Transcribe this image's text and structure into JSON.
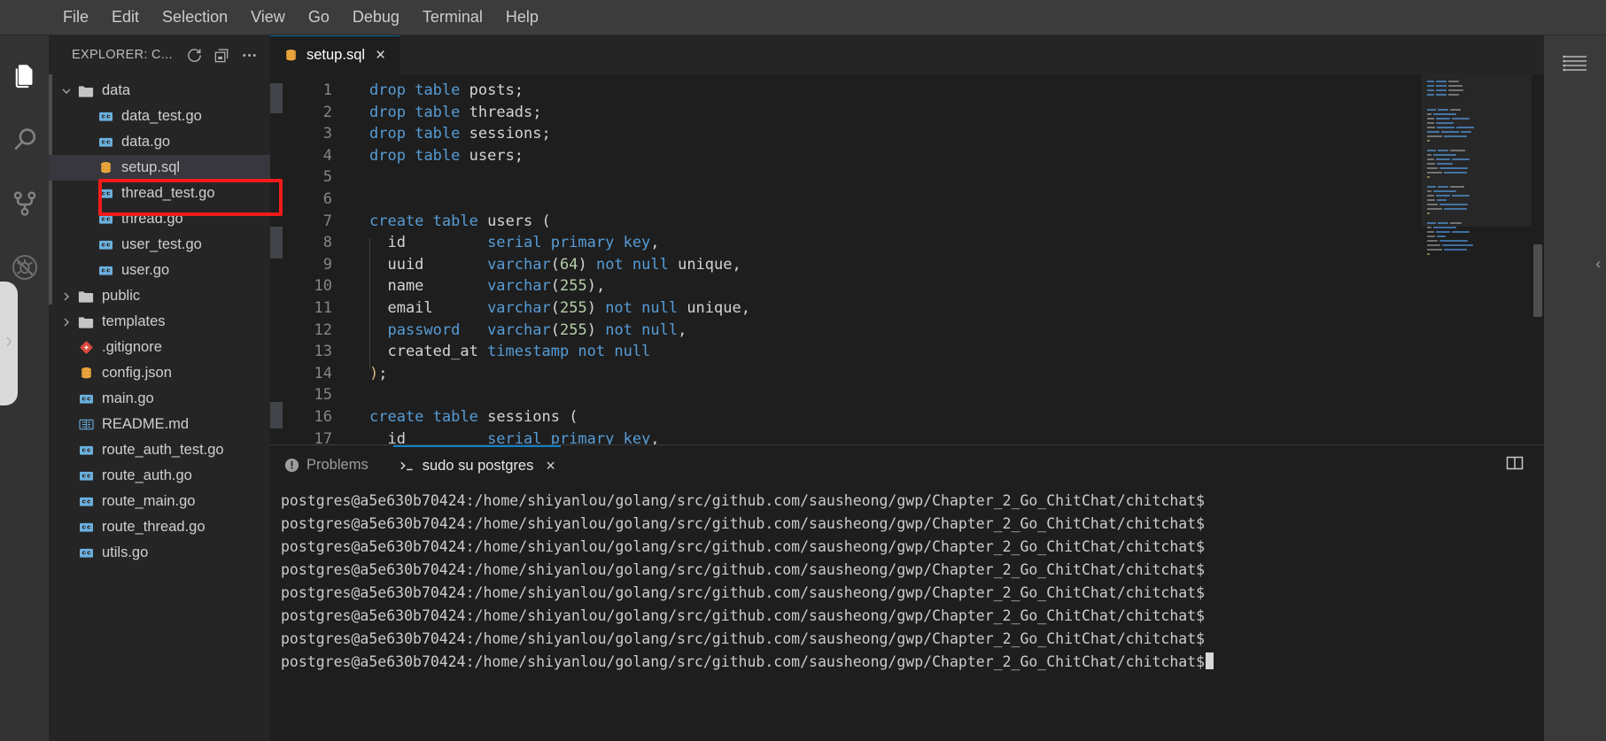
{
  "menubar": {
    "items": [
      {
        "label": "File"
      },
      {
        "label": "Edit"
      },
      {
        "label": "Selection"
      },
      {
        "label": "View"
      },
      {
        "label": "Go"
      },
      {
        "label": "Debug"
      },
      {
        "label": "Terminal"
      },
      {
        "label": "Help"
      }
    ]
  },
  "activitybar": {
    "items": [
      {
        "name": "explorer-icon",
        "title": "Explorer",
        "active": true
      },
      {
        "name": "search-icon",
        "title": "Search",
        "active": false
      },
      {
        "name": "source-control-icon",
        "title": "Source Control",
        "active": false
      },
      {
        "name": "debug-disabled-icon",
        "title": "Run and Debug",
        "active": false
      }
    ]
  },
  "sidebar": {
    "title": "EXPLORER: C...",
    "actions": [
      {
        "name": "refresh-icon",
        "title": "Refresh Explorer"
      },
      {
        "name": "collapse-all-icon",
        "title": "Collapse Folders in Explorer"
      },
      {
        "name": "more-actions-icon",
        "title": "Views and More Actions..."
      }
    ],
    "tree": [
      {
        "label": "data",
        "icon": "folder-open-icon",
        "kind": "folder",
        "expanded": true,
        "depth": 1,
        "selected": false
      },
      {
        "label": "data_test.go",
        "icon": "go-file-icon",
        "kind": "file",
        "depth": 2,
        "selected": false
      },
      {
        "label": "data.go",
        "icon": "go-file-icon",
        "kind": "file",
        "depth": 2,
        "selected": false
      },
      {
        "label": "setup.sql",
        "icon": "sql-file-icon",
        "kind": "file",
        "depth": 2,
        "selected": true
      },
      {
        "label": "thread_test.go",
        "icon": "go-file-icon",
        "kind": "file",
        "depth": 2,
        "selected": false
      },
      {
        "label": "thread.go",
        "icon": "go-file-icon",
        "kind": "file",
        "depth": 2,
        "selected": false
      },
      {
        "label": "user_test.go",
        "icon": "go-file-icon",
        "kind": "file",
        "depth": 2,
        "selected": false
      },
      {
        "label": "user.go",
        "icon": "go-file-icon",
        "kind": "file",
        "depth": 2,
        "selected": false
      },
      {
        "label": "public",
        "icon": "folder-icon",
        "kind": "folder",
        "expanded": false,
        "depth": 1,
        "selected": false
      },
      {
        "label": "templates",
        "icon": "folder-icon",
        "kind": "folder",
        "expanded": false,
        "depth": 1,
        "selected": false
      },
      {
        "label": ".gitignore",
        "icon": "git-file-icon",
        "kind": "file",
        "depth": 1,
        "selected": false
      },
      {
        "label": "config.json",
        "icon": "json-file-icon",
        "kind": "file",
        "depth": 1,
        "selected": false
      },
      {
        "label": "main.go",
        "icon": "go-file-icon",
        "kind": "file",
        "depth": 1,
        "selected": false
      },
      {
        "label": "README.md",
        "icon": "markdown-file-icon",
        "kind": "file",
        "depth": 1,
        "selected": false
      },
      {
        "label": "route_auth_test.go",
        "icon": "go-file-icon",
        "kind": "file",
        "depth": 1,
        "selected": false
      },
      {
        "label": "route_auth.go",
        "icon": "go-file-icon",
        "kind": "file",
        "depth": 1,
        "selected": false
      },
      {
        "label": "route_main.go",
        "icon": "go-file-icon",
        "kind": "file",
        "depth": 1,
        "selected": false
      },
      {
        "label": "route_thread.go",
        "icon": "go-file-icon",
        "kind": "file",
        "depth": 1,
        "selected": false
      },
      {
        "label": "utils.go",
        "icon": "go-file-icon",
        "kind": "file",
        "depth": 1,
        "selected": false
      }
    ],
    "highlight_target": "setup.sql",
    "highlight_color": "#f31b1b"
  },
  "editor": {
    "tabs": [
      {
        "label": "setup.sql",
        "icon": "sql-file-icon",
        "active": true,
        "close": "×"
      }
    ],
    "language": "sql",
    "first_visible_line": 1,
    "last_visible_line": 17,
    "lines": [
      {
        "n": 1,
        "tokens": [
          {
            "t": "drop",
            "c": "kw"
          },
          {
            "t": " ",
            "c": "pln"
          },
          {
            "t": "table",
            "c": "kw"
          },
          {
            "t": " posts;",
            "c": "pln"
          }
        ]
      },
      {
        "n": 2,
        "tokens": [
          {
            "t": "drop",
            "c": "kw"
          },
          {
            "t": " ",
            "c": "pln"
          },
          {
            "t": "table",
            "c": "kw"
          },
          {
            "t": " threads;",
            "c": "pln"
          }
        ]
      },
      {
        "n": 3,
        "tokens": [
          {
            "t": "drop",
            "c": "kw"
          },
          {
            "t": " ",
            "c": "pln"
          },
          {
            "t": "table",
            "c": "kw"
          },
          {
            "t": " sessions;",
            "c": "pln"
          }
        ]
      },
      {
        "n": 4,
        "tokens": [
          {
            "t": "drop",
            "c": "kw"
          },
          {
            "t": " ",
            "c": "pln"
          },
          {
            "t": "table",
            "c": "kw"
          },
          {
            "t": " users;",
            "c": "pln"
          }
        ]
      },
      {
        "n": 5,
        "tokens": []
      },
      {
        "n": 6,
        "tokens": []
      },
      {
        "n": 7,
        "tokens": [
          {
            "t": "create",
            "c": "kw"
          },
          {
            "t": " ",
            "c": "pln"
          },
          {
            "t": "table",
            "c": "kw"
          },
          {
            "t": " users (",
            "c": "pln"
          }
        ]
      },
      {
        "n": 8,
        "tokens": [
          {
            "t": "  id         ",
            "c": "pln"
          },
          {
            "t": "serial primary key",
            "c": "kw"
          },
          {
            "t": ",",
            "c": "pln"
          }
        ]
      },
      {
        "n": 9,
        "tokens": [
          {
            "t": "  uuid       ",
            "c": "pln"
          },
          {
            "t": "varchar",
            "c": "typ"
          },
          {
            "t": "(",
            "c": "punc"
          },
          {
            "t": "64",
            "c": "num"
          },
          {
            "t": ")",
            "c": "punc"
          },
          {
            "t": " ",
            "c": "pln"
          },
          {
            "t": "not null",
            "c": "kw"
          },
          {
            "t": " unique,",
            "c": "pln"
          }
        ]
      },
      {
        "n": 10,
        "tokens": [
          {
            "t": "  name       ",
            "c": "pln"
          },
          {
            "t": "varchar",
            "c": "typ"
          },
          {
            "t": "(",
            "c": "punc"
          },
          {
            "t": "255",
            "c": "num"
          },
          {
            "t": ")",
            "c": "punc"
          },
          {
            "t": ",",
            "c": "pln"
          }
        ]
      },
      {
        "n": 11,
        "tokens": [
          {
            "t": "  email      ",
            "c": "pln"
          },
          {
            "t": "varchar",
            "c": "typ"
          },
          {
            "t": "(",
            "c": "punc"
          },
          {
            "t": "255",
            "c": "num"
          },
          {
            "t": ")",
            "c": "punc"
          },
          {
            "t": " ",
            "c": "pln"
          },
          {
            "t": "not null",
            "c": "kw"
          },
          {
            "t": " unique,",
            "c": "pln"
          }
        ]
      },
      {
        "n": 12,
        "tokens": [
          {
            "t": "  ",
            "c": "pln"
          },
          {
            "t": "password",
            "c": "kw"
          },
          {
            "t": "   ",
            "c": "pln"
          },
          {
            "t": "varchar",
            "c": "typ"
          },
          {
            "t": "(",
            "c": "punc"
          },
          {
            "t": "255",
            "c": "num"
          },
          {
            "t": ")",
            "c": "punc"
          },
          {
            "t": " ",
            "c": "pln"
          },
          {
            "t": "not null",
            "c": "kw"
          },
          {
            "t": ",",
            "c": "pln"
          }
        ]
      },
      {
        "n": 13,
        "tokens": [
          {
            "t": "  created_at ",
            "c": "pln"
          },
          {
            "t": "timestamp not null",
            "c": "kw"
          }
        ]
      },
      {
        "n": 14,
        "tokens": [
          {
            "t": ")",
            "c": "br"
          },
          {
            "t": ";",
            "c": "pln"
          }
        ]
      },
      {
        "n": 15,
        "tokens": []
      },
      {
        "n": 16,
        "tokens": [
          {
            "t": "create",
            "c": "kw"
          },
          {
            "t": " ",
            "c": "pln"
          },
          {
            "t": "table",
            "c": "kw"
          },
          {
            "t": " sessions (",
            "c": "pln"
          }
        ]
      },
      {
        "n": 17,
        "tokens": [
          {
            "t": "  id         ",
            "c": "pln"
          },
          {
            "t": "serial primary key",
            "c": "kw"
          },
          {
            "t": ",",
            "c": "pln"
          }
        ]
      }
    ],
    "minimap": {
      "blocks": [
        [
          [
            14,
            "kw"
          ],
          [
            20,
            "kw"
          ],
          [
            22,
            "pln"
          ]
        ],
        [
          [
            14,
            "kw"
          ],
          [
            20,
            "kw"
          ],
          [
            28,
            "pln"
          ]
        ],
        [
          [
            14,
            "kw"
          ],
          [
            20,
            "kw"
          ],
          [
            30,
            "pln"
          ]
        ],
        [
          [
            14,
            "kw"
          ],
          [
            20,
            "kw"
          ],
          [
            22,
            "pln"
          ]
        ],
        [],
        [],
        [
          [
            18,
            "kw"
          ],
          [
            20,
            "kw"
          ],
          [
            20,
            "pln"
          ]
        ],
        [
          [
            8,
            "pln"
          ],
          [
            46,
            "kw"
          ]
        ],
        [
          [
            14,
            "pln"
          ],
          [
            28,
            "typ"
          ],
          [
            34,
            "kw"
          ]
        ],
        [
          [
            14,
            "pln"
          ],
          [
            34,
            "typ"
          ]
        ],
        [
          [
            16,
            "pln"
          ],
          [
            34,
            "typ"
          ],
          [
            34,
            "kw"
          ]
        ],
        [
          [
            24,
            "kw"
          ],
          [
            34,
            "typ"
          ],
          [
            22,
            "kw"
          ]
        ],
        [
          [
            30,
            "pln"
          ],
          [
            44,
            "kw"
          ]
        ],
        [
          [
            6,
            "br"
          ]
        ],
        [],
        [
          [
            18,
            "kw"
          ],
          [
            20,
            "kw"
          ],
          [
            30,
            "pln"
          ]
        ],
        [
          [
            8,
            "pln"
          ],
          [
            46,
            "kw"
          ]
        ],
        [
          [
            14,
            "pln"
          ],
          [
            28,
            "typ"
          ],
          [
            34,
            "kw"
          ]
        ],
        [
          [
            16,
            "pln"
          ],
          [
            30,
            "typ"
          ]
        ],
        [
          [
            20,
            "pln"
          ],
          [
            56,
            "kw"
          ]
        ],
        [
          [
            30,
            "pln"
          ],
          [
            44,
            "kw"
          ]
        ],
        [
          [
            6,
            "br"
          ]
        ],
        [],
        [
          [
            18,
            "kw"
          ],
          [
            20,
            "kw"
          ],
          [
            28,
            "pln"
          ]
        ],
        [
          [
            8,
            "pln"
          ],
          [
            46,
            "kw"
          ]
        ],
        [
          [
            14,
            "pln"
          ],
          [
            28,
            "typ"
          ],
          [
            34,
            "kw"
          ]
        ],
        [
          [
            16,
            "pln"
          ],
          [
            18,
            "kw"
          ]
        ],
        [
          [
            20,
            "pln"
          ],
          [
            56,
            "kw"
          ]
        ],
        [
          [
            30,
            "pln"
          ],
          [
            44,
            "kw"
          ]
        ],
        [
          [
            6,
            "br"
          ]
        ],
        [],
        [
          [
            18,
            "kw"
          ],
          [
            20,
            "kw"
          ],
          [
            22,
            "pln"
          ]
        ],
        [
          [
            8,
            "pln"
          ],
          [
            46,
            "kw"
          ]
        ],
        [
          [
            14,
            "pln"
          ],
          [
            28,
            "typ"
          ],
          [
            34,
            "kw"
          ]
        ],
        [
          [
            16,
            "pln"
          ],
          [
            16,
            "kw"
          ]
        ],
        [
          [
            20,
            "pln"
          ],
          [
            56,
            "kw"
          ]
        ],
        [
          [
            26,
            "pln"
          ],
          [
            60,
            "kw"
          ]
        ],
        [
          [
            30,
            "pln"
          ],
          [
            44,
            "kw"
          ]
        ],
        [
          [
            6,
            "br"
          ]
        ]
      ]
    }
  },
  "panel": {
    "tabs": [
      {
        "label": "Problems",
        "icon": "warning-icon",
        "active": false
      },
      {
        "label": "sudo su postgres",
        "icon": "terminal-prompt-icon",
        "active": true,
        "close": "×"
      }
    ],
    "actions": [
      {
        "name": "split-terminal-icon",
        "title": "Split Terminal"
      }
    ],
    "terminal": {
      "prompt": "postgres@a5e630b70424:/home/shiyanlou/golang/src/github.com/sausheong/gwp/Chapter_2_Go_ChitChat/chitchat$",
      "lines": [
        "postgres@a5e630b70424:/home/shiyanlou/golang/src/github.com/sausheong/gwp/Chapter_2_Go_ChitChat/chitchat$",
        "postgres@a5e630b70424:/home/shiyanlou/golang/src/github.com/sausheong/gwp/Chapter_2_Go_ChitChat/chitchat$",
        "postgres@a5e630b70424:/home/shiyanlou/golang/src/github.com/sausheong/gwp/Chapter_2_Go_ChitChat/chitchat$",
        "postgres@a5e630b70424:/home/shiyanlou/golang/src/github.com/sausheong/gwp/Chapter_2_Go_ChitChat/chitchat$",
        "postgres@a5e630b70424:/home/shiyanlou/golang/src/github.com/sausheong/gwp/Chapter_2_Go_ChitChat/chitchat$",
        "postgres@a5e630b70424:/home/shiyanlou/golang/src/github.com/sausheong/gwp/Chapter_2_Go_ChitChat/chitchat$",
        "postgres@a5e630b70424:/home/shiyanlou/golang/src/github.com/sausheong/gwp/Chapter_2_Go_ChitChat/chitchat$",
        "postgres@a5e630b70424:/home/shiyanlou/golang/src/github.com/sausheong/gwp/Chapter_2_Go_ChitChat/chitchat$"
      ]
    }
  },
  "farright": {
    "icons": [
      {
        "name": "list-lines-icon",
        "title": "Outline"
      }
    ]
  },
  "colors": {
    "accent": "#0e82c8",
    "editor_bg": "#1e1e1e",
    "sidebar_bg": "#252526",
    "activitybar_bg": "#333333",
    "menubar_bg": "#3c3c3c",
    "keyword": "#569cd6",
    "number": "#b5cea8",
    "plain": "#d4d4d4",
    "highlight_red": "#f31b1b",
    "sql_icon_orange": "#e8a33d",
    "go_icon_blue": "#6ab0de"
  }
}
